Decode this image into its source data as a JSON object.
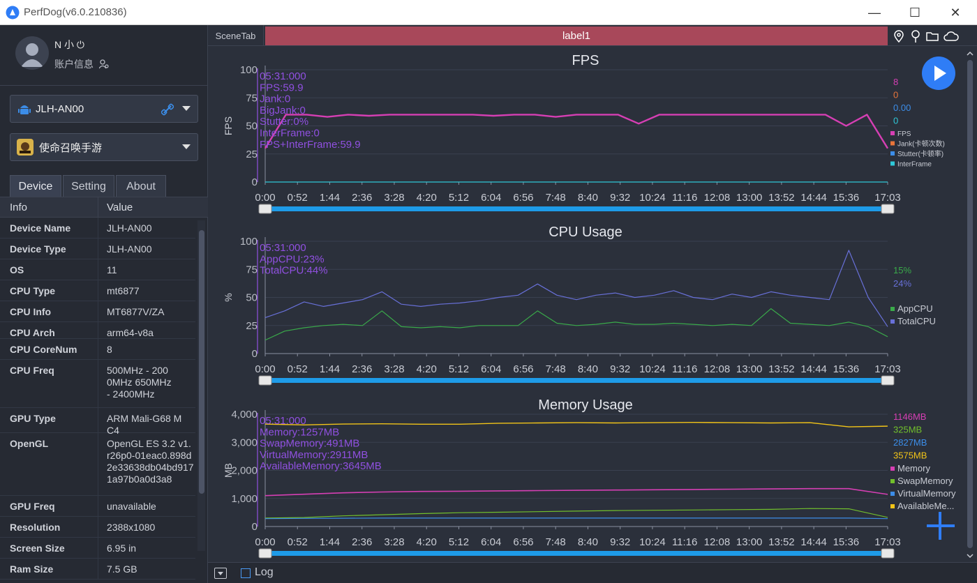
{
  "window": {
    "title": "PerfDog(v6.0.210836)",
    "minimize_glyph": "—",
    "maximize_glyph": "☐",
    "close_glyph": "✕"
  },
  "user": {
    "name": "N 小 ⏻",
    "account_label": "账户信息"
  },
  "device_selector": {
    "value": "JLH-AN00"
  },
  "app_selector": {
    "value": "使命召唤手游"
  },
  "tabs": [
    {
      "label": "Device"
    },
    {
      "label": "Setting"
    },
    {
      "label": "About"
    }
  ],
  "info_table": {
    "headers": [
      "Info",
      "Value"
    ],
    "rows": [
      {
        "key": "Device Name",
        "value": "JLH-AN00"
      },
      {
        "key": "Device Type",
        "value": "JLH-AN00"
      },
      {
        "key": "OS",
        "value": "11"
      },
      {
        "key": "CPU Type",
        "value": "mt6877"
      },
      {
        "key": "CPU Info",
        "value": "MT6877V/ZA"
      },
      {
        "key": "CPU Arch",
        "value": "arm64-v8a"
      },
      {
        "key": "CPU CoreNum",
        "value": "8"
      },
      {
        "key": "CPU Freq",
        "value": "500MHz - 2000MHz 650MHz - 2400MHz"
      },
      {
        "key": "GPU Type",
        "value": "ARM Mali-G68 MC4"
      },
      {
        "key": "OpenGL",
        "value": "OpenGL ES 3.2 v1.r26p0-01eac0.898d2e33638db04bd9171a97b0a0d3a8"
      },
      {
        "key": "GPU Freq",
        "value": "unavailable"
      },
      {
        "key": "Resolution",
        "value": "2388x1080"
      },
      {
        "key": "Screen Size",
        "value": "6.95 in"
      },
      {
        "key": "Ram Size",
        "value": "7.5 GB"
      }
    ]
  },
  "topbar": {
    "scene_tab": "SceneTab",
    "label": "label1"
  },
  "bottombar": {
    "log_label": "Log"
  },
  "colors": {
    "fps": "#d63fb4",
    "jank": "#e8753a",
    "stutter": "#3c8de8",
    "interframe": "#2fc8d8",
    "app_cpu": "#3aaa4a",
    "total_cpu": "#6870d8",
    "memory": "#d63fb4",
    "swap": "#72c02c",
    "virtual": "#3c8de8",
    "available": "#f2c418",
    "cursor": "#9050e0",
    "timeline": "#1e9be8"
  },
  "chart_data": [
    {
      "type": "line",
      "title": "FPS",
      "ylabel": "FPS",
      "ylim": [
        0,
        100
      ],
      "yticks": [
        0,
        25,
        50,
        75,
        100
      ],
      "xticks": [
        "0:00",
        "0:52",
        "1:44",
        "2:36",
        "3:28",
        "4:20",
        "5:12",
        "6:04",
        "6:56",
        "7:48",
        "8:40",
        "9:32",
        "10:24",
        "11:16",
        "12:08",
        "13:00",
        "13:52",
        "14:44",
        "15:36",
        "17:03"
      ],
      "grid": true,
      "legend": "right",
      "cursor_time": "5:31",
      "cursor_labels": [
        "05:31:000",
        "FPS:59.9",
        "Jank:0",
        "BigJank:0",
        "Stutter:0%",
        "InterFrame:0",
        "FPS+InterFrame:59.9"
      ],
      "current_values": [
        "8",
        "0",
        "0.00",
        "0"
      ],
      "series": [
        {
          "name": "FPS",
          "values": [
            30,
            60,
            60,
            58,
            60,
            59,
            60,
            60,
            60,
            60,
            60,
            59,
            60,
            60,
            58,
            60,
            60,
            60,
            52,
            60,
            60,
            60,
            60,
            60,
            60,
            60,
            60,
            60,
            50,
            60,
            30
          ]
        },
        {
          "name": "Jank(卡顿次数)",
          "values": [
            0,
            0,
            0,
            0,
            0,
            0,
            0,
            0,
            0,
            0,
            0,
            0,
            0,
            0,
            0,
            0,
            0,
            0,
            0,
            0,
            0,
            0,
            0,
            0,
            0,
            0,
            0,
            0,
            0,
            0,
            0
          ]
        },
        {
          "name": "Stutter(卡顿率)",
          "values": [
            0,
            0,
            0,
            0,
            0,
            0,
            0,
            0,
            0,
            0,
            0,
            0,
            0,
            0,
            0,
            0,
            0,
            0,
            0,
            0,
            0,
            0,
            0,
            0,
            0,
            0,
            0,
            0,
            0,
            0,
            0
          ]
        },
        {
          "name": "InterFrame",
          "values": [
            0,
            0,
            0,
            0,
            0,
            0,
            0,
            0,
            0,
            0,
            0,
            0,
            0,
            0,
            0,
            0,
            0,
            0,
            0,
            0,
            0,
            0,
            0,
            0,
            0,
            0,
            0,
            0,
            0,
            0,
            0
          ]
        }
      ]
    },
    {
      "type": "line",
      "title": "CPU Usage",
      "ylabel": "%",
      "ylim": [
        0,
        100
      ],
      "yticks": [
        0,
        25,
        50,
        75,
        100
      ],
      "xticks": [
        "0:00",
        "0:52",
        "1:44",
        "2:36",
        "3:28",
        "4:20",
        "5:12",
        "6:04",
        "6:56",
        "7:48",
        "8:40",
        "9:32",
        "10:24",
        "11:16",
        "12:08",
        "13:00",
        "13:52",
        "14:44",
        "15:36",
        "17:03"
      ],
      "grid": true,
      "legend": "right",
      "cursor_time": "5:31",
      "cursor_labels": [
        "05:31:000",
        "AppCPU:23%",
        "TotalCPU:44%"
      ],
      "current_values": [
        "15%",
        "24%"
      ],
      "series": [
        {
          "name": "AppCPU",
          "values": [
            12,
            20,
            23,
            25,
            26,
            25,
            38,
            24,
            23,
            24,
            23,
            25,
            25,
            25,
            38,
            27,
            25,
            26,
            28,
            26,
            26,
            27,
            26,
            25,
            26,
            25,
            40,
            27,
            26,
            25,
            28,
            24,
            15
          ]
        },
        {
          "name": "TotalCPU",
          "values": [
            32,
            38,
            46,
            42,
            45,
            48,
            55,
            44,
            42,
            44,
            45,
            47,
            50,
            52,
            62,
            52,
            48,
            52,
            54,
            50,
            52,
            56,
            50,
            48,
            53,
            50,
            55,
            52,
            50,
            48,
            92,
            50,
            24
          ]
        }
      ]
    },
    {
      "type": "line",
      "title": "Memory Usage",
      "ylabel": "MB",
      "ylim": [
        0,
        4000
      ],
      "yticks": [
        0,
        1000,
        2000,
        3000,
        4000
      ],
      "ytick_labels": [
        "0",
        "1,000",
        "2,000",
        "3,000",
        "4,000"
      ],
      "xticks": [
        "0:00",
        "0:52",
        "1:44",
        "2:36",
        "3:28",
        "4:20",
        "5:12",
        "6:04",
        "6:56",
        "7:48",
        "8:40",
        "9:32",
        "10:24",
        "11:16",
        "12:08",
        "13:00",
        "13:52",
        "14:44",
        "15:36",
        "17:03"
      ],
      "grid": true,
      "legend": "right",
      "cursor_time": "5:31",
      "cursor_labels": [
        "05:31:000",
        "Memory:1257MB",
        "SwapMemory:491MB",
        "VirtualMemory:2911MB",
        "AvailableMemory:3645MB"
      ],
      "current_values": [
        "1146MB",
        "325MB",
        "2827MB",
        "3575MB"
      ],
      "series": [
        {
          "name": "Memory",
          "values": [
            1100,
            1150,
            1200,
            1230,
            1250,
            1257,
            1270,
            1280,
            1290,
            1300,
            1310,
            1320,
            1330,
            1340,
            1350,
            1350,
            1146
          ]
        },
        {
          "name": "SwapMemory",
          "values": [
            300,
            320,
            380,
            420,
            460,
            491,
            510,
            530,
            550,
            570,
            580,
            590,
            600,
            610,
            640,
            630,
            325
          ]
        },
        {
          "name": "VirtualMemory",
          "values": [
            280,
            290,
            295,
            300,
            300,
            300,
            300,
            300,
            300,
            300,
            300,
            300,
            300,
            300,
            300,
            300,
            280
          ]
        },
        {
          "name": "AvailableMe...",
          "values": [
            3650,
            3620,
            3650,
            3660,
            3645,
            3645,
            3680,
            3690,
            3700,
            3690,
            3700,
            3710,
            3700,
            3690,
            3700,
            3550,
            3575
          ]
        }
      ]
    }
  ]
}
